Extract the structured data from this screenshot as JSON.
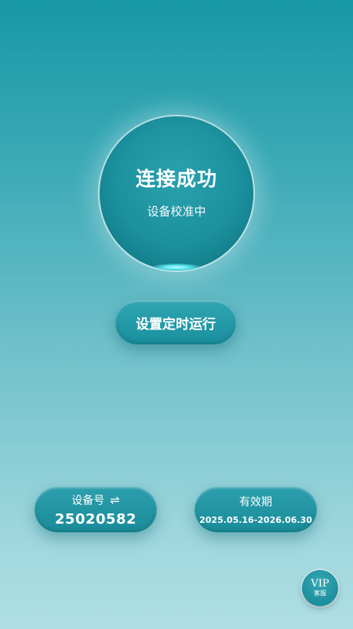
{
  "status": {
    "title": "连接成功",
    "subtitle": "设备校准中"
  },
  "timer_button": {
    "label": "设置定时运行"
  },
  "device_card": {
    "label": "设备号",
    "swap_icon": "⇌",
    "value": "25020582"
  },
  "validity_card": {
    "label": "有效期",
    "value": "2025.05.16-2026.06.30"
  },
  "vip": {
    "label": "VIP",
    "sublabel": "客服"
  },
  "colors": {
    "primary": "#1a8f9d",
    "background_top": "#1897a6",
    "background_bottom": "#aedfe4",
    "glow": "#5fe8f2"
  }
}
